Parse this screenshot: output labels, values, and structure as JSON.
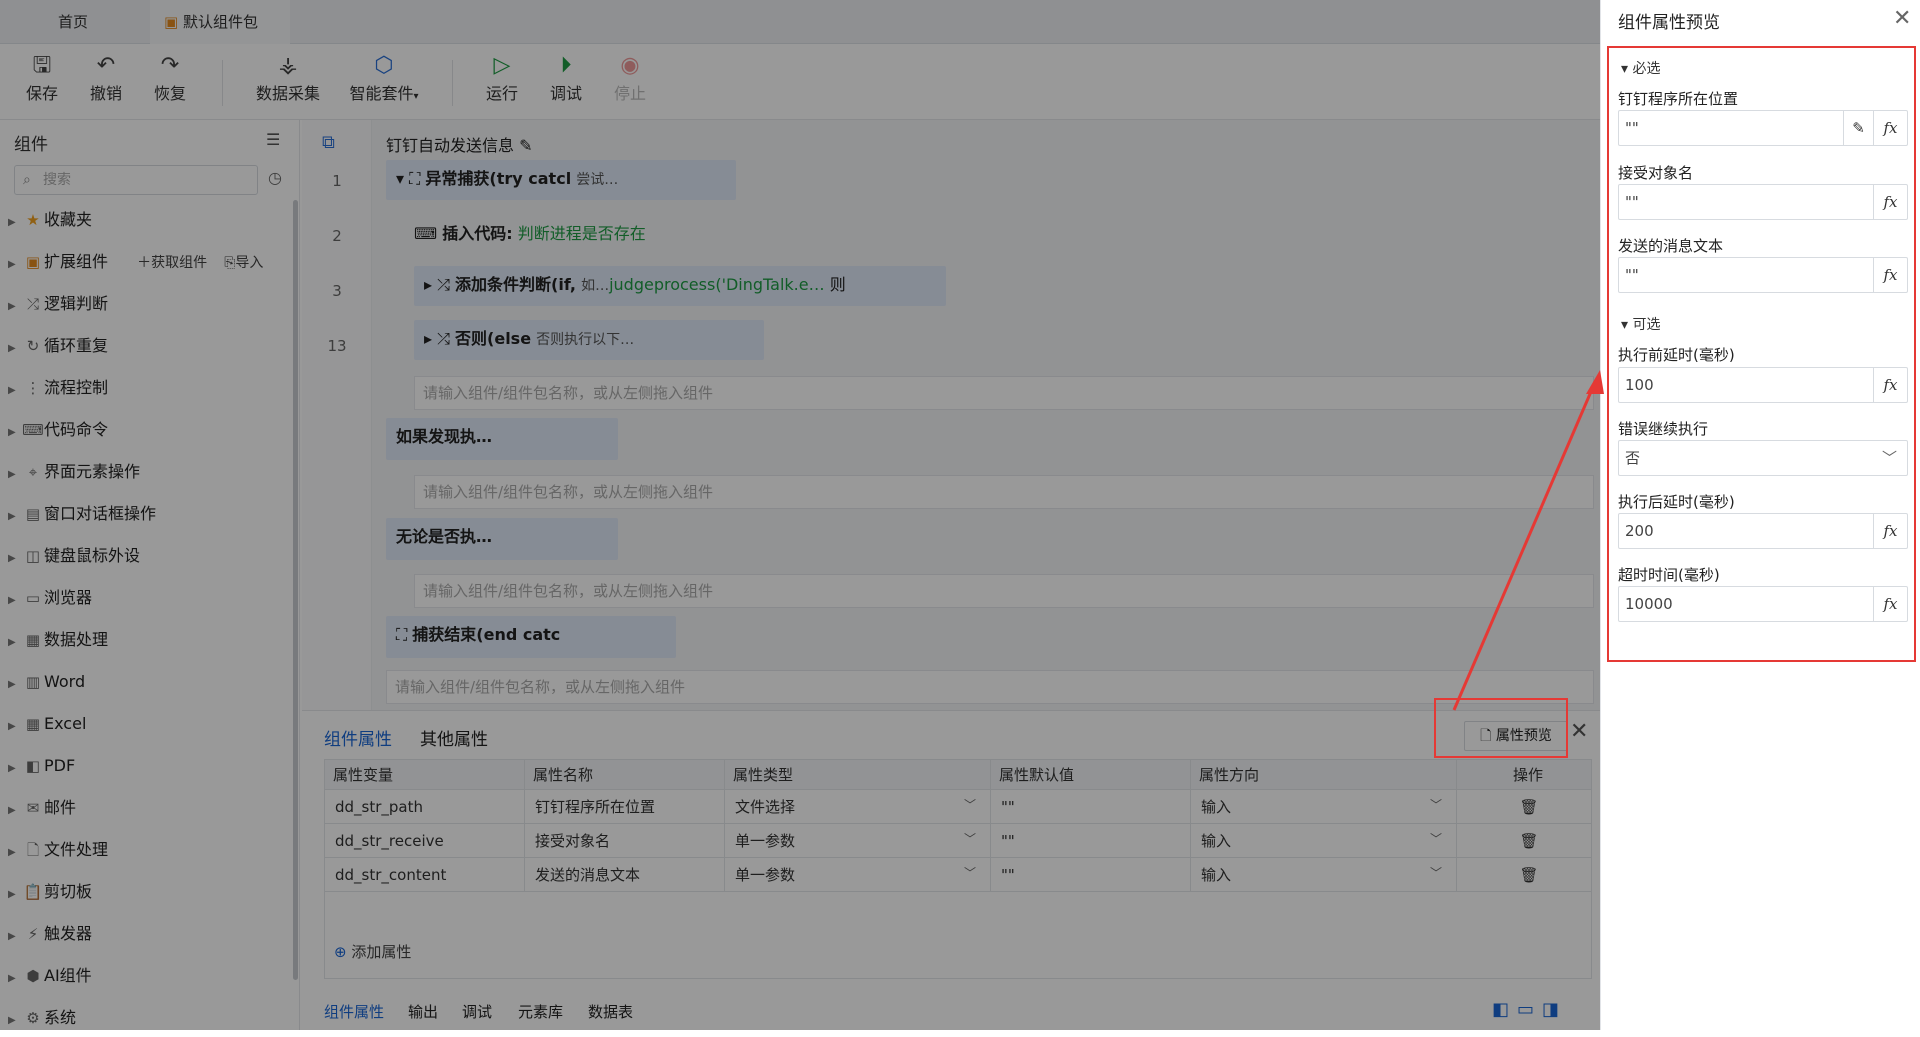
{
  "tabs": {
    "home": "首页",
    "package": "默认组件包"
  },
  "toolbar": {
    "save": "保存",
    "undo": "撤销",
    "redo": "恢复",
    "data_collect": "数据采集",
    "smart_kit": "智能套件",
    "run": "运行",
    "debug": "调试",
    "stop": "停止"
  },
  "left": {
    "title": "组件",
    "search_placeholder": "搜索",
    "get_component": "获取组件",
    "import": "导入",
    "items": [
      "收藏夹",
      "扩展组件",
      "逻辑判断",
      "循环重复",
      "流程控制",
      "代码命令",
      "界面元素操作",
      "窗口对话框操作",
      "键盘鼠标外设",
      "浏览器",
      "数据处理",
      "Word",
      "Excel",
      "PDF",
      "邮件",
      "文件处理",
      "剪切板",
      "触发器",
      "AI组件",
      "系统"
    ]
  },
  "editor": {
    "title": "钉钉自动发送信息",
    "line_numbers": [
      "1",
      "2",
      "3",
      "13"
    ],
    "try_label": "异常捕获(try catcl",
    "try_desc": "尝试…",
    "insert_code": "插入代码:",
    "insert_code_desc": "判断进程是否存在",
    "if_label": "添加条件判断(if,",
    "if_desc": "如…",
    "if_expr": "judgeprocess('DingTalk.e…",
    "if_then": "则",
    "else_label": "否则(else",
    "else_desc": "否则执行以下…",
    "hint": "请输入组件/组件包名称，或从左侧拖入组件",
    "catch_label": "如果发现执…",
    "finally_label": "无论是否执…",
    "end_label": "捕获结束(end catc"
  },
  "props": {
    "tab_component": "组件属性",
    "tab_other": "其他属性",
    "preview_button": "属性预览",
    "headers": [
      "属性变量",
      "属性名称",
      "属性类型",
      "属性默认值",
      "属性方向",
      "操作"
    ],
    "rows": [
      {
        "var": "dd_str_path",
        "name": "钉钉程序所在位置",
        "type": "文件选择",
        "default": "\"\"",
        "dir": "输入"
      },
      {
        "var": "dd_str_receive",
        "name": "接受对象名",
        "type": "单一参数",
        "default": "\"\"",
        "dir": "输入"
      },
      {
        "var": "dd_str_content",
        "name": "发送的消息文本",
        "type": "单一参数",
        "default": "\"\"",
        "dir": "输入"
      }
    ],
    "add_attr": "添加属性",
    "bottom_tabs": [
      "组件属性",
      "输出",
      "调试",
      "元素库",
      "数据表"
    ]
  },
  "preview": {
    "title": "组件属性预览",
    "required": "必选",
    "optional": "可选",
    "fields": {
      "dd_path_label": "钉钉程序所在位置",
      "dd_path_value": "\"\"",
      "receive_label": "接受对象名",
      "receive_value": "\"\"",
      "content_label": "发送的消息文本",
      "content_value": "\"\"",
      "pre_delay_label": "执行前延时(毫秒)",
      "pre_delay_value": "100",
      "error_continue_label": "错误继续执行",
      "error_continue_value": "否",
      "post_delay_label": "执行后延时(毫秒)",
      "post_delay_value": "200",
      "timeout_label": "超时时间(毫秒)",
      "timeout_value": "10000"
    },
    "fx": "fx"
  },
  "colors": {
    "accent": "#1a66d6",
    "highlight": "#e53935",
    "code_green": "#1e9c44"
  }
}
